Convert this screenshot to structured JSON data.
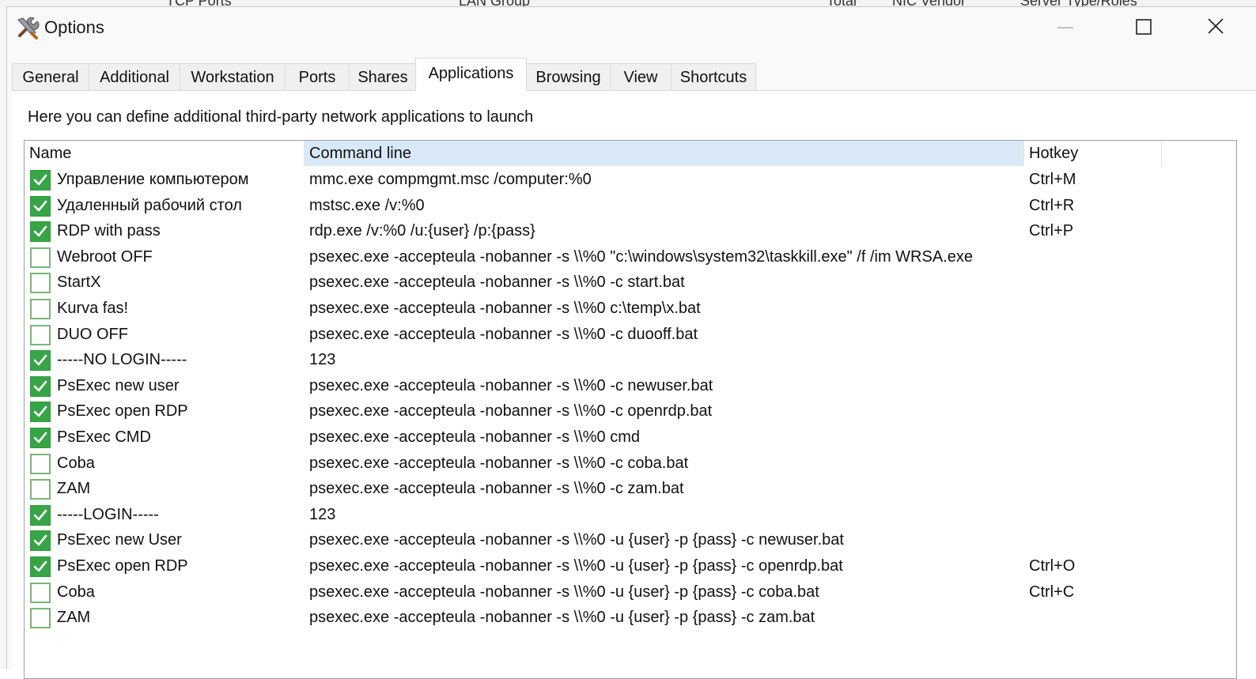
{
  "background_window": {
    "columns": [
      "TCP Ports",
      "LAN Group",
      "Total",
      "NIC Vendor",
      "Server Type/Roles"
    ]
  },
  "window": {
    "title": "Options",
    "icon": "tools-icon"
  },
  "tabs": [
    {
      "label": "General",
      "active": false
    },
    {
      "label": "Additional",
      "active": false
    },
    {
      "label": "Workstation",
      "active": false
    },
    {
      "label": "Ports",
      "active": false
    },
    {
      "label": "Shares",
      "active": false
    },
    {
      "label": "Applications",
      "active": true
    },
    {
      "label": "Browsing",
      "active": false
    },
    {
      "label": "View",
      "active": false
    },
    {
      "label": "Shortcuts",
      "active": false
    }
  ],
  "applications": {
    "description": "Here you can define additional third-party network applications to launch",
    "columns": {
      "name": "Name",
      "command": "Command line",
      "hotkey": "Hotkey"
    },
    "sorted_column": "command",
    "rows": [
      {
        "checked": true,
        "name": "Управление компьютером",
        "command": "mmc.exe compmgmt.msc /computer:%0",
        "hotkey": "Ctrl+M"
      },
      {
        "checked": true,
        "name": "Удаленный рабочий стол",
        "command": "mstsc.exe /v:%0",
        "hotkey": "Ctrl+R"
      },
      {
        "checked": true,
        "name": "RDP with pass",
        "command": "rdp.exe /v:%0 /u:{user} /p:{pass}",
        "hotkey": "Ctrl+P"
      },
      {
        "checked": false,
        "name": "Webroot OFF",
        "command": "psexec.exe -accepteula -nobanner -s \\\\%0 \"c:\\windows\\system32\\taskkill.exe\" /f /im WRSA.exe",
        "hotkey": ""
      },
      {
        "checked": false,
        "name": "StartX",
        "command": "psexec.exe -accepteula -nobanner -s \\\\%0 -c start.bat",
        "hotkey": ""
      },
      {
        "checked": false,
        "name": "Kurva fas!",
        "command": "psexec.exe -accepteula -nobanner -s \\\\%0 c:\\temp\\x.bat",
        "hotkey": ""
      },
      {
        "checked": false,
        "name": "DUO OFF",
        "command": "psexec.exe -accepteula -nobanner -s \\\\%0 -c duooff.bat",
        "hotkey": ""
      },
      {
        "checked": true,
        "name": "-----NO LOGIN-----",
        "command": "123",
        "hotkey": ""
      },
      {
        "checked": true,
        "name": "PsExec new user",
        "command": "psexec.exe -accepteula -nobanner -s \\\\%0 -c newuser.bat",
        "hotkey": ""
      },
      {
        "checked": true,
        "name": "PsExec open RDP",
        "command": "psexec.exe -accepteula -nobanner -s \\\\%0 -c openrdp.bat",
        "hotkey": ""
      },
      {
        "checked": true,
        "name": "PsExec CMD",
        "command": "psexec.exe -accepteula -nobanner -s \\\\%0 cmd",
        "hotkey": ""
      },
      {
        "checked": false,
        "name": "Coba",
        "command": "psexec.exe -accepteula -nobanner -s \\\\%0 -c coba.bat",
        "hotkey": ""
      },
      {
        "checked": false,
        "name": "ZAM",
        "command": "psexec.exe -accepteula -nobanner -s \\\\%0 -c zam.bat",
        "hotkey": ""
      },
      {
        "checked": true,
        "name": "-----LOGIN-----",
        "command": "123",
        "hotkey": ""
      },
      {
        "checked": true,
        "name": "PsExec new User",
        "command": "psexec.exe -accepteula -nobanner -s \\\\%0 -u {user} -p {pass} -c newuser.bat",
        "hotkey": ""
      },
      {
        "checked": true,
        "name": "PsExec open RDP",
        "command": "psexec.exe -accepteula -nobanner -s \\\\%0 -u {user} -p {pass} -c openrdp.bat",
        "hotkey": "Ctrl+O"
      },
      {
        "checked": false,
        "name": "Coba",
        "command": "psexec.exe -accepteula -nobanner -s \\\\%0 -u {user} -p {pass} -c coba.bat",
        "hotkey": "Ctrl+C"
      },
      {
        "checked": false,
        "name": "ZAM",
        "command": "psexec.exe -accepteula -nobanner -s \\\\%0 -u {user} -p {pass} -c zam.bat",
        "hotkey": ""
      }
    ]
  },
  "colors": {
    "checkbox_checked": "#37a546",
    "header_sorted": "#d9e8f7"
  }
}
